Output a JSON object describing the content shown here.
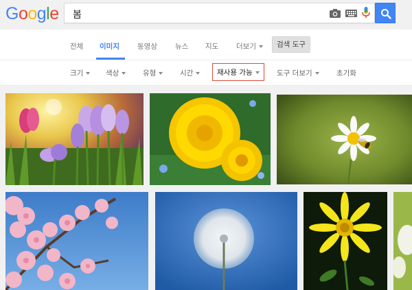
{
  "logo": {
    "letters": [
      "G",
      "o",
      "o",
      "g",
      "l",
      "e"
    ],
    "colors": [
      "#4285f4",
      "#ea4335",
      "#fbbc05",
      "#4285f4",
      "#34a853",
      "#ea4335"
    ]
  },
  "search": {
    "value": "봄"
  },
  "icons": {
    "camera": "camera-icon",
    "keyboard": "keyboard-icon",
    "mic": "mic-icon",
    "search": "search-icon"
  },
  "tabs": {
    "all": "전체",
    "images": "이미지",
    "videos": "동영상",
    "news": "뉴스",
    "maps": "지도",
    "more": "더보기",
    "tools": "검색 도구"
  },
  "tools": {
    "size": "크기",
    "color": "색상",
    "type": "유형",
    "time": "시간",
    "usage_rights": "재사용 가능",
    "more_tools": "도구 더보기",
    "clear": "초기화"
  },
  "colors": {
    "accent": "#4285f4",
    "highlight_border": "#dd4b39"
  },
  "images": [
    {
      "subject": "crocus"
    },
    {
      "subject": "dandelion-flower"
    },
    {
      "subject": "daisy-with-bee"
    },
    {
      "subject": "cherry-blossom"
    },
    {
      "subject": "dandelion-seedhead"
    },
    {
      "subject": "yellow-daisy"
    },
    {
      "subject": "white-flower-partial"
    }
  ]
}
